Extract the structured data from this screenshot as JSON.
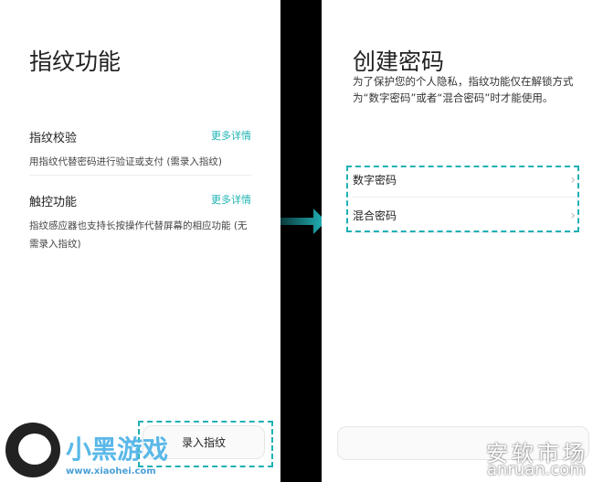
{
  "left": {
    "title": "指纹功能",
    "items": [
      {
        "title": "指纹校验",
        "more": "更多详情",
        "desc": "用指纹代替密码进行验证或支付 (需录入指纹)"
      },
      {
        "title": "触控功能",
        "more": "更多详情",
        "desc": "指纹感应器也支持长按操作代替屏幕的相应功能 (无需录入指纹)"
      }
    ],
    "button": "录入指纹"
  },
  "right": {
    "title": "创建密码",
    "desc": "为了保护您的个人隐私，指纹功能仅在解锁方式为“数字密码”或者“混合密码”时才能使用。",
    "options": [
      {
        "label": "数字密码"
      },
      {
        "label": "混合密码"
      }
    ],
    "chevron": "›"
  },
  "watermarks": {
    "left": "小黑游戏",
    "left_url": "www.xiaohei.com",
    "right": "安软市场",
    "right_url": "anruan.com"
  },
  "colors": {
    "accent": "#1eb0b4"
  }
}
